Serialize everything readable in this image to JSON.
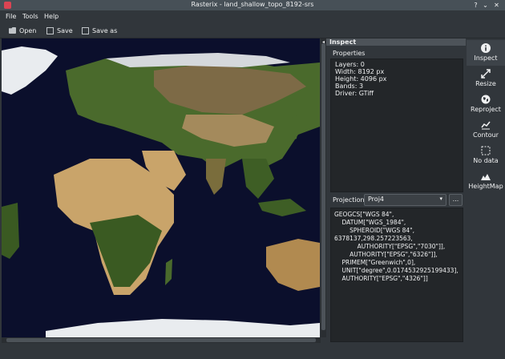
{
  "window": {
    "title": "Rasterix - land_shallow_topo_8192-srs"
  },
  "menu": [
    "File",
    "Tools",
    "Help"
  ],
  "toolbar": {
    "open": "Open",
    "save": "Save",
    "save_as": "Save as"
  },
  "panel": {
    "title": "Inspect",
    "properties_label": "Properties",
    "properties": [
      "Layers: 0",
      "Width: 8192 px",
      "Height: 4096 px",
      "Bands: 3",
      "Driver: GTiff"
    ],
    "projection_label": "Projection",
    "projection_value": "Proj4",
    "projection_more": "...",
    "wkt": [
      "GEOGCS[\"WGS 84\",",
      "    DATUM[\"WGS_1984\",",
      "        SPHEROID[\"WGS 84\",",
      "6378137,298.257223563,",
      "            AUTHORITY[\"EPSG\",\"7030\"]],",
      "        AUTHORITY[\"EPSG\",\"6326\"]],",
      "    PRIMEM[\"Greenwich\",0],",
      "    UNIT[\"degree\",0.0174532925199433],",
      "    AUTHORITY[\"EPSG\",\"4326\"]]"
    ]
  },
  "sidebar": [
    {
      "label": "Inspect",
      "icon": "info-icon"
    },
    {
      "label": "Resize",
      "icon": "resize-icon"
    },
    {
      "label": "Reproject",
      "icon": "globe-icon"
    },
    {
      "label": "Contour",
      "icon": "contour-icon"
    },
    {
      "label": "No data",
      "icon": "nodata-icon"
    },
    {
      "label": "HeightMap",
      "icon": "heightmap-icon"
    }
  ]
}
